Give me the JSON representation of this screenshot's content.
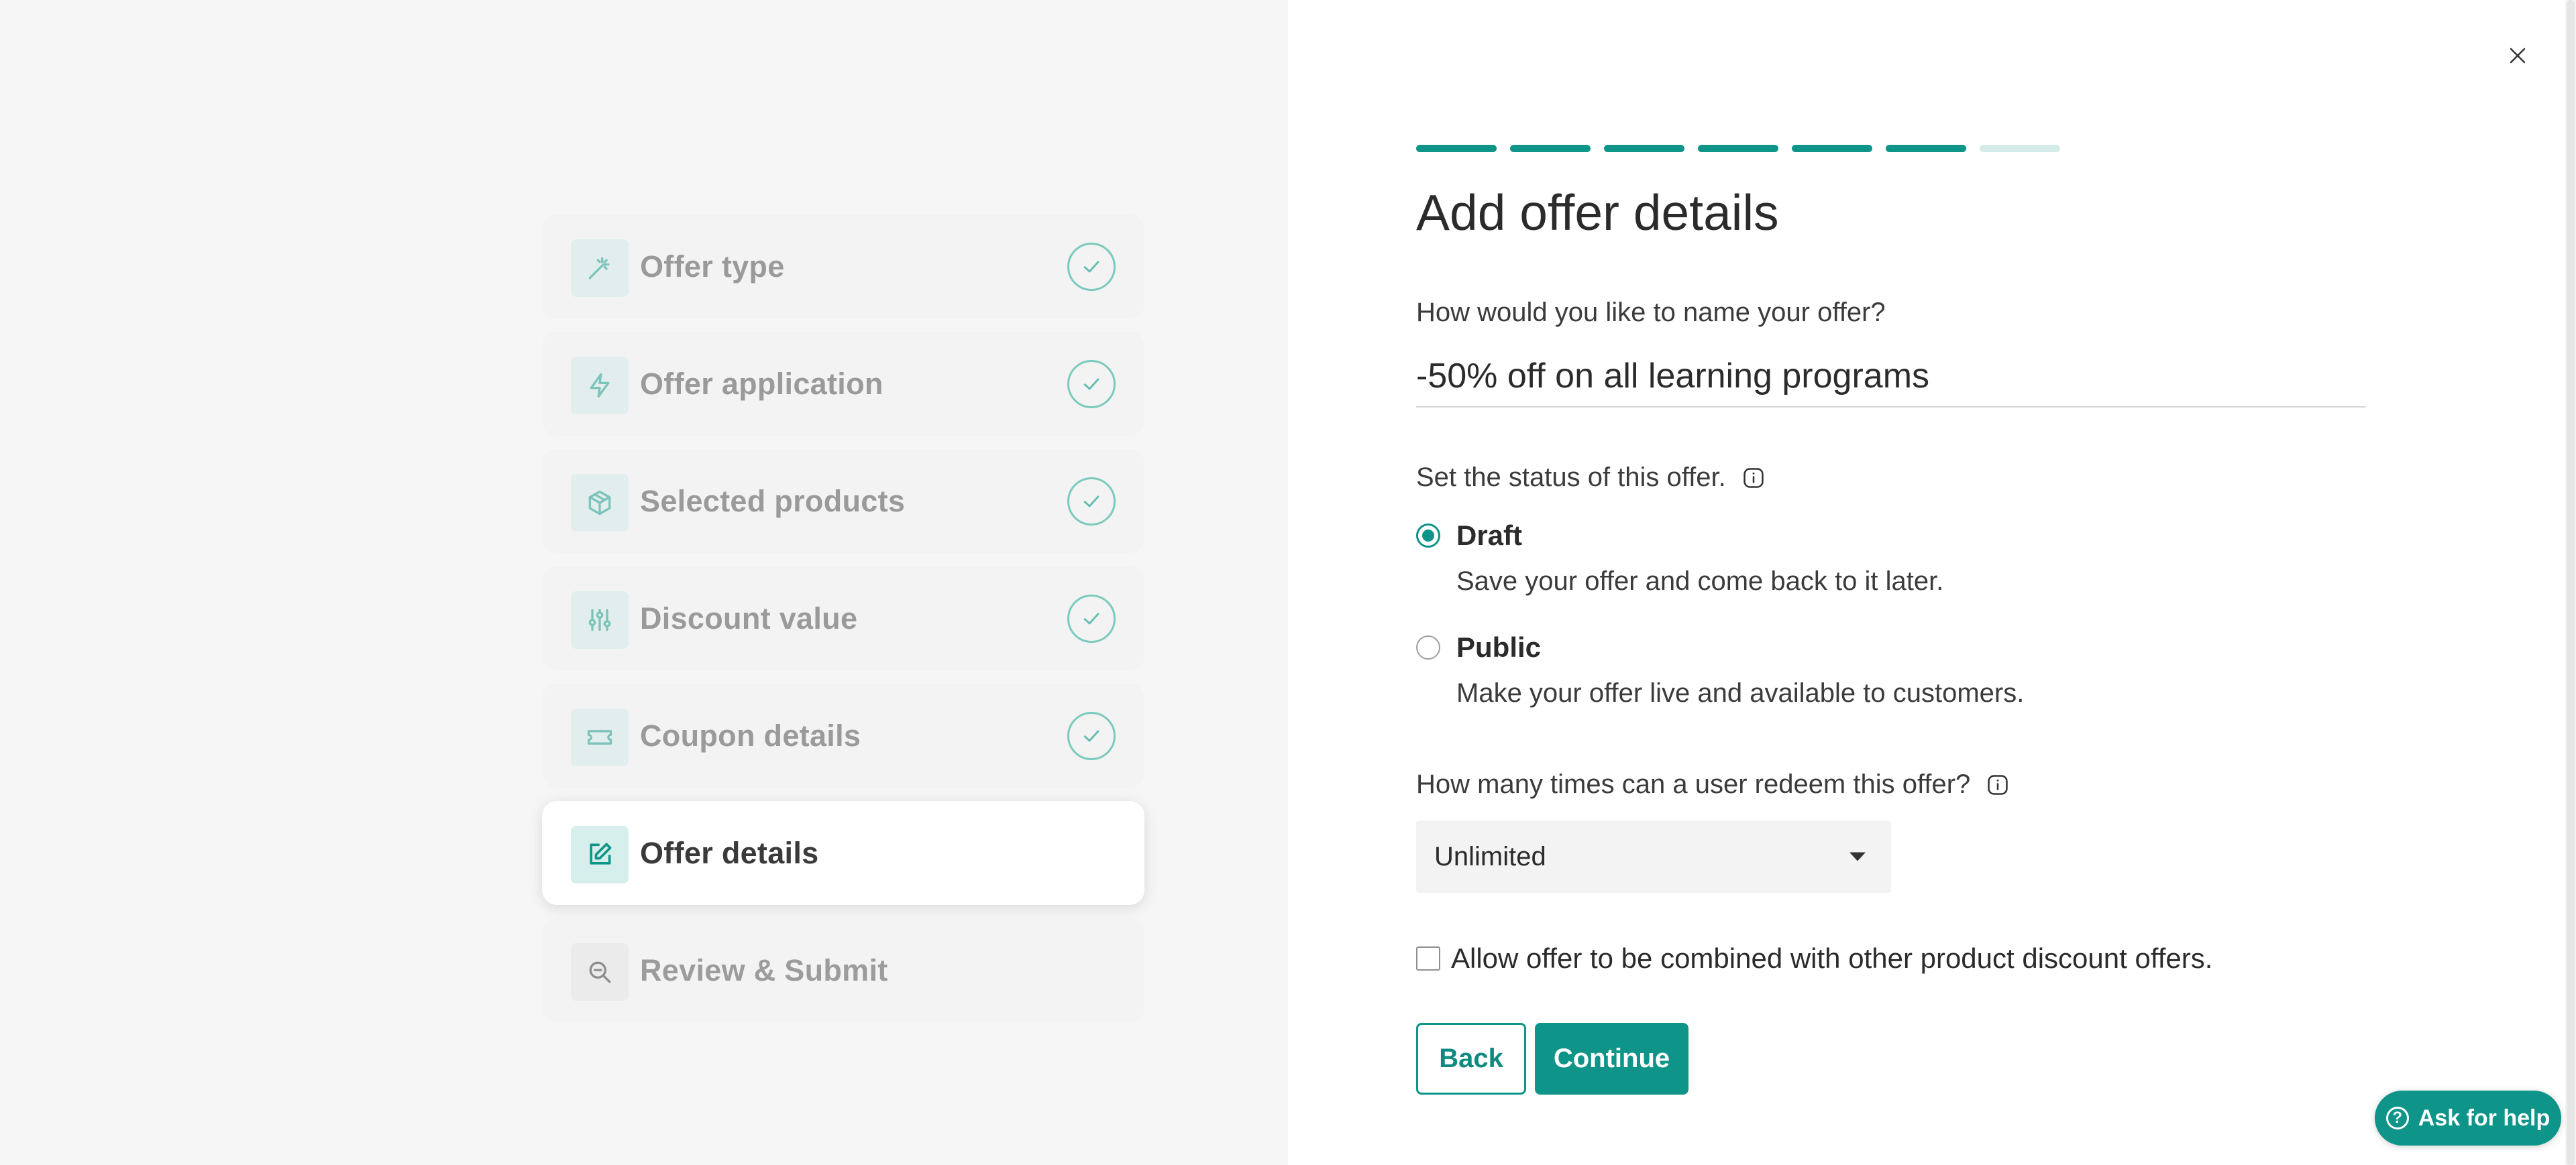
{
  "steps": [
    {
      "label": "Offer type",
      "icon": "magic-wand-icon",
      "state": "done"
    },
    {
      "label": "Offer application",
      "icon": "lightning-icon",
      "state": "done"
    },
    {
      "label": "Selected products",
      "icon": "box-icon",
      "state": "done"
    },
    {
      "label": "Discount value",
      "icon": "sliders-icon",
      "state": "done"
    },
    {
      "label": "Coupon details",
      "icon": "ticket-icon",
      "state": "done"
    },
    {
      "label": "Offer details",
      "icon": "edit-icon",
      "state": "active"
    },
    {
      "label": "Review & Submit",
      "icon": "search-zoom-icon",
      "state": "future"
    }
  ],
  "progress": {
    "completed": 6,
    "total": 7
  },
  "form": {
    "title": "Add offer details",
    "name_question": "How would you like to name your offer?",
    "name_value": "-50% off on all learning programs",
    "status_label": "Set the status of this offer.",
    "status_options": [
      {
        "title": "Draft",
        "description": "Save your offer and come back to it later.",
        "checked": true
      },
      {
        "title": "Public",
        "description": "Make your offer live and available to customers.",
        "checked": false
      }
    ],
    "redeem_question": "How many times can a user redeem this offer?",
    "redeem_value": "Unlimited",
    "combine_label": "Allow offer to be combined with other product discount offers.",
    "combine_checked": false,
    "back_label": "Back",
    "continue_label": "Continue"
  },
  "help": {
    "label": "Ask for help",
    "icon": "question-circle-icon"
  },
  "colors": {
    "accent": "#0e9488",
    "accent_light": "#d3ecea",
    "check_ring": "#7ccabf"
  }
}
